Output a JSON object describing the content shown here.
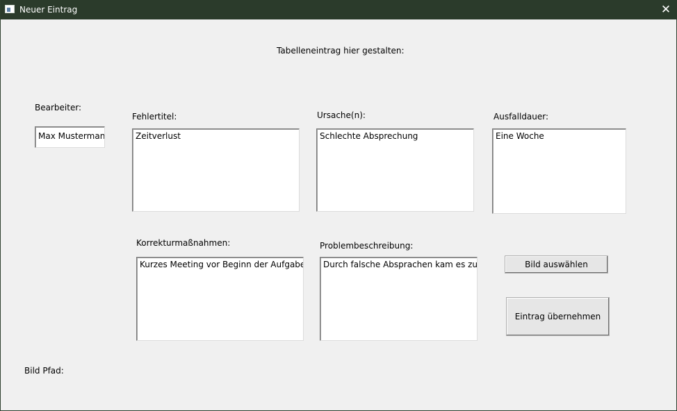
{
  "window": {
    "title": "Neuer Eintrag",
    "close_glyph": "✕"
  },
  "header": {
    "instruction": "Tabelleneintrag hier gestalten:"
  },
  "form": {
    "bearbeiter": {
      "label": "Bearbeiter:",
      "value": "Max Mustermann"
    },
    "fehlertitel": {
      "label": "Fehlertitel:",
      "value": "Zeitverlust"
    },
    "ursache": {
      "label": "Ursache(n):",
      "value": "Schlechte Absprechung"
    },
    "ausfalldauer": {
      "label": "Ausfalldauer:",
      "value": "Eine Woche"
    },
    "korrektur": {
      "label": "Korrekturmaßnahmen:",
      "value": "Kurzes Meeting vor Beginn der Aufgabe"
    },
    "problem": {
      "label": "Problembeschreibung:",
      "value": "Durch falsche Absprachen kam es zu Mi"
    }
  },
  "buttons": {
    "bild_auswaehlen": "Bild auswählen",
    "eintrag_uebernehmen": "Eintrag übernehmen"
  },
  "footer": {
    "bild_pfad_label": "Bild Pfad:"
  },
  "icons": {
    "app": "window-app-icon",
    "close": "close-icon"
  }
}
